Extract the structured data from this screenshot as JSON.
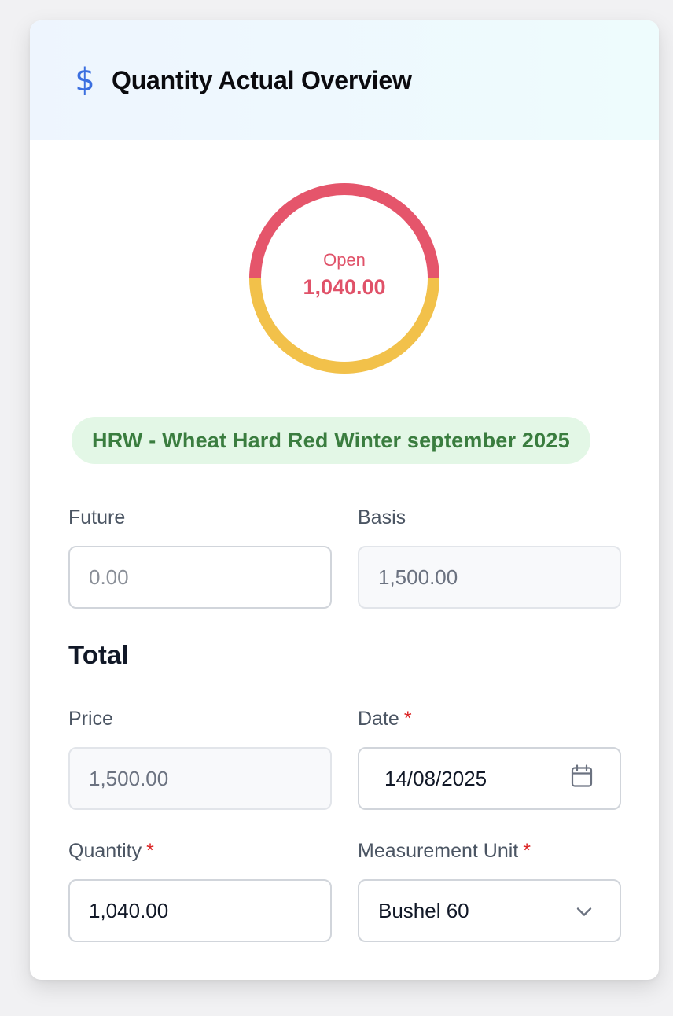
{
  "header": {
    "icon": "dollar-icon",
    "icon_glyph": "$",
    "title": "Quantity Actual Overview"
  },
  "donut": {
    "label": "Open",
    "value": "1,040.00",
    "colors": {
      "top": "#e5556b",
      "bottom": "#f2c14a"
    },
    "split_fraction_top": 0.5
  },
  "commodity_badge": "HRW - Wheat Hard Red Winter september 2025",
  "fields": {
    "future": {
      "label": "Future",
      "value": "0.00"
    },
    "basis": {
      "label": "Basis",
      "value": "1,500.00"
    },
    "total_title": "Total",
    "price": {
      "label": "Price",
      "value": "1,500.00"
    },
    "date": {
      "label": "Date",
      "required": "*",
      "value": "14/08/2025",
      "icon": "calendar-icon"
    },
    "quantity": {
      "label": "Quantity",
      "required": "*",
      "value": "1,040.00"
    },
    "measurement_unit": {
      "label": "Measurement Unit",
      "required": "*",
      "value": "Bushel 60",
      "icon": "chevron-down-icon"
    }
  },
  "colors": {
    "accent_blue": "#3b6fe0",
    "badge_bg": "#e3f7e6",
    "badge_text": "#3a7d3f",
    "required": "#dc2626"
  }
}
